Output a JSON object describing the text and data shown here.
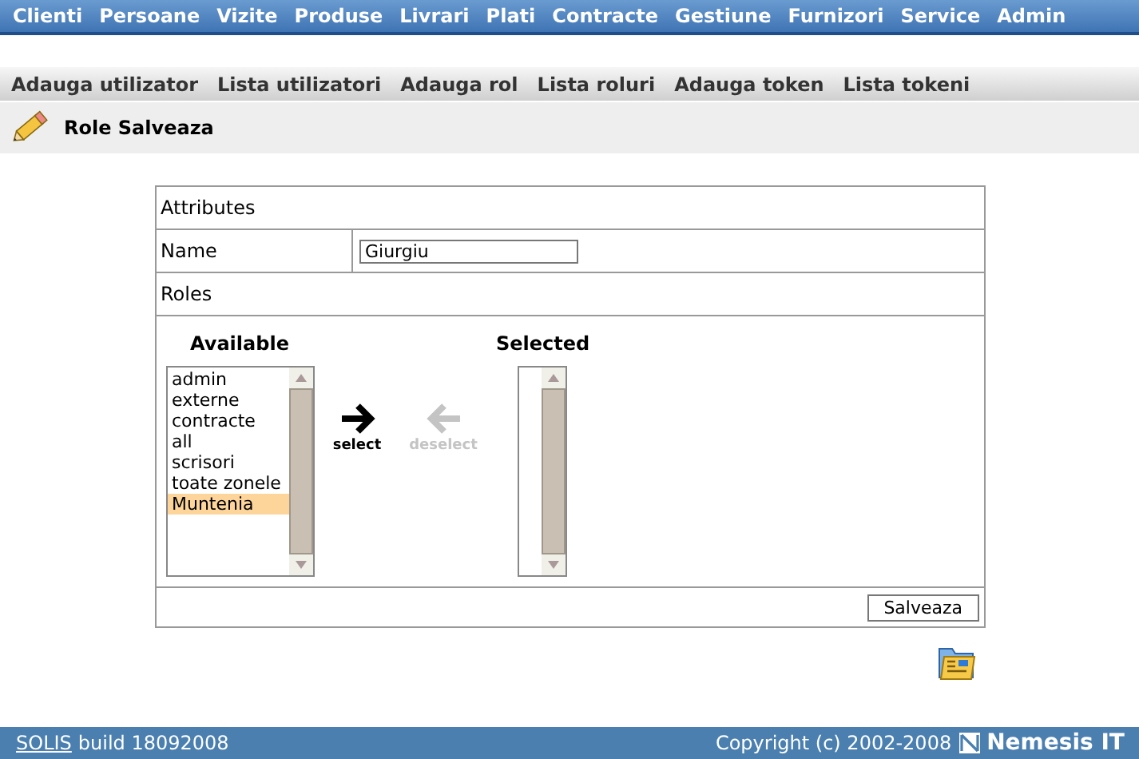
{
  "top_menu": [
    {
      "label": "Clienti"
    },
    {
      "label": "Persoane"
    },
    {
      "label": "Vizite"
    },
    {
      "label": "Produse"
    },
    {
      "label": "Livrari"
    },
    {
      "label": "Plati"
    },
    {
      "label": "Contracte"
    },
    {
      "label": "Gestiune"
    },
    {
      "label": "Furnizori"
    },
    {
      "label": "Service"
    },
    {
      "label": "Admin"
    }
  ],
  "sub_menu": [
    {
      "label": "Adauga utilizator"
    },
    {
      "label": "Lista utilizatori"
    },
    {
      "label": "Adauga rol"
    },
    {
      "label": "Lista roluri"
    },
    {
      "label": "Adauga token"
    },
    {
      "label": "Lista tokeni"
    }
  ],
  "page_title": "Role Salveaza",
  "form": {
    "section_title": "Attributes",
    "name_label": "Name",
    "name_value": "Giurgiu",
    "roles_label": "Roles",
    "available_heading": "Available",
    "available": [
      {
        "label": "admin",
        "selected": false
      },
      {
        "label": "externe",
        "selected": false
      },
      {
        "label": "contracte",
        "selected": false
      },
      {
        "label": "all",
        "selected": false
      },
      {
        "label": "scrisori",
        "selected": false
      },
      {
        "label": "toate zonele",
        "selected": false
      },
      {
        "label": "Muntenia",
        "selected": true
      }
    ],
    "select_button": {
      "label": "select",
      "disabled": false
    },
    "deselect_button": {
      "label": "deselect",
      "disabled": true
    },
    "selected_heading": "Selected",
    "save_button": "Salveaza"
  },
  "footer": {
    "link": "SOLIS",
    "build": "build 18092008",
    "copyright": "Copyright (c) 2002-2008",
    "brand": "Nemesis IT"
  }
}
